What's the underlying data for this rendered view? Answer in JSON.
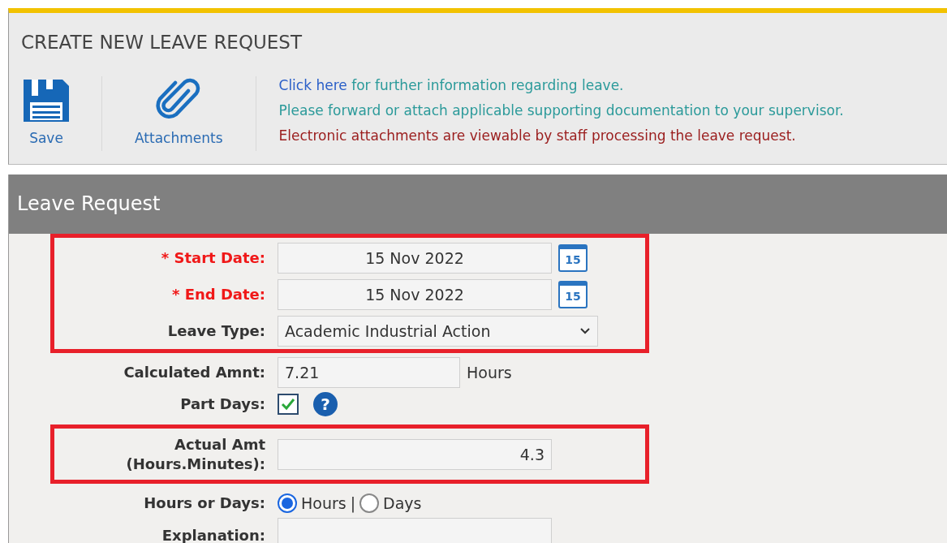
{
  "header": {
    "title": "CREATE NEW LEAVE REQUEST",
    "toolbar": [
      {
        "kind": "save",
        "label": "Save"
      },
      {
        "kind": "attach",
        "label": "Attachments"
      }
    ],
    "notices": [
      {
        "kind": "link",
        "link": "Click here",
        "text": " for further information regarding leave."
      },
      {
        "kind": "info",
        "text": "Please forward or attach applicable supporting documentation to your supervisor."
      },
      {
        "kind": "warning",
        "text": "Electronic attachments are viewable by staff processing the leave request."
      }
    ]
  },
  "panel": {
    "title": "Leave Request",
    "groups": [
      {
        "highlighted": true,
        "fields": [
          {
            "kind": "date",
            "label": "* Start Date:",
            "required": true,
            "value": "15 Nov 2022",
            "calendar_day": "15"
          },
          {
            "kind": "date",
            "label": "* End Date:",
            "required": true,
            "value": "15 Nov 2022",
            "calendar_day": "15"
          },
          {
            "kind": "select",
            "label": "Leave Type:",
            "required": false,
            "value": "Academic Industrial Action"
          }
        ]
      },
      {
        "highlighted": false,
        "fields": [
          {
            "kind": "amount",
            "label": "Calculated Amnt:",
            "value": "7.21",
            "unit": "Hours"
          },
          {
            "kind": "checkbox",
            "label": "Part Days:",
            "checked": true,
            "help": "?"
          }
        ]
      },
      {
        "highlighted": true,
        "fields": [
          {
            "kind": "decimal",
            "label": "Actual Amt (Hours.Minutes):",
            "value": "4.3"
          }
        ]
      },
      {
        "highlighted": false,
        "fields": [
          {
            "kind": "radio",
            "label": "Hours or Days:",
            "separator": "|",
            "options": [
              {
                "label": "Hours",
                "selected": true
              },
              {
                "label": "Days",
                "selected": false
              }
            ]
          },
          {
            "kind": "textarea",
            "label": "Explanation:"
          }
        ]
      }
    ]
  }
}
